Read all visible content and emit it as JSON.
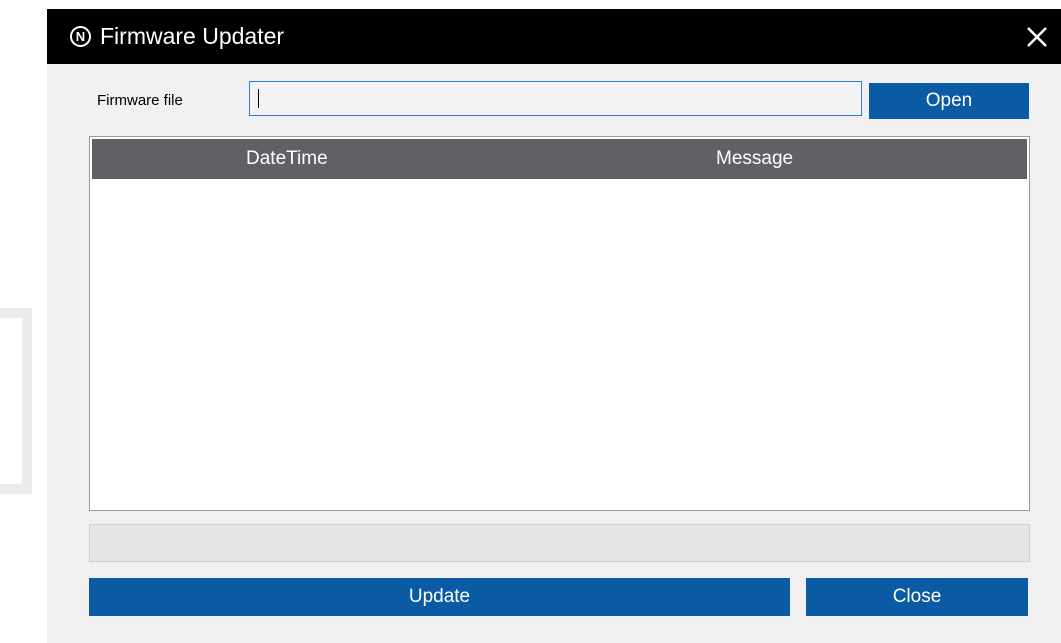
{
  "window": {
    "app_icon_letter": "N",
    "title": "Firmware Updater",
    "close_icon": "close-icon"
  },
  "firmware_file": {
    "label": "Firmware file",
    "value": "",
    "open_label": "Open"
  },
  "log": {
    "columns": [
      "DateTime",
      "Message"
    ],
    "rows": []
  },
  "progress": {
    "value": 0
  },
  "actions": {
    "update_label": "Update",
    "close_label": "Close"
  },
  "colors": {
    "titlebar": "#000000",
    "button_accent": "#0a5aa4",
    "table_header": "#5f6166",
    "input_focus_border": "#2a7fd4",
    "window_bg": "#f0f0f0"
  }
}
